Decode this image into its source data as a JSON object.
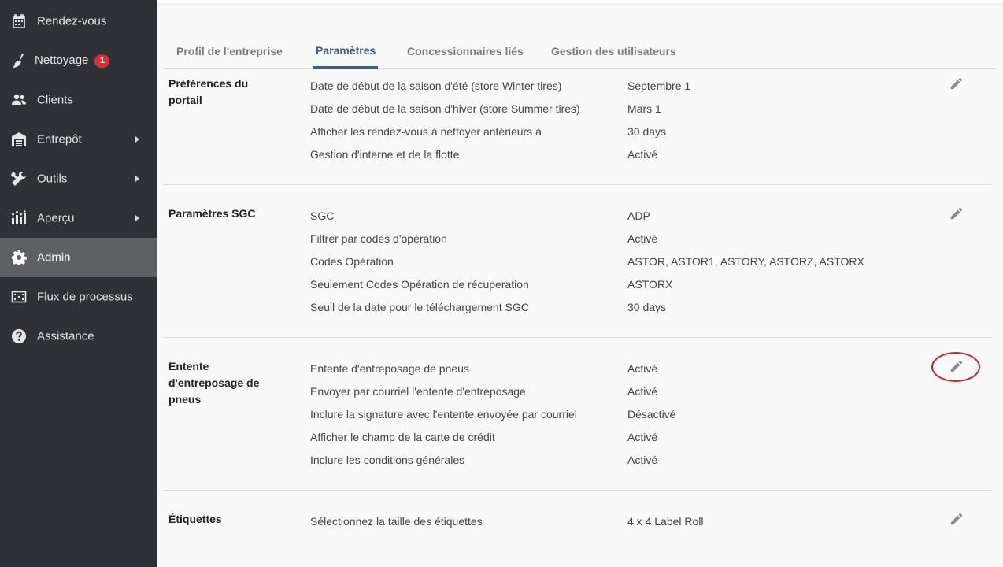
{
  "sidebar": {
    "items": [
      {
        "label": "Rendez-vous",
        "icon": "calendar-icon"
      },
      {
        "label": "Nettoyage",
        "icon": "broom-icon",
        "badge": "1"
      },
      {
        "label": "Clients",
        "icon": "users-icon"
      },
      {
        "label": "Entrepôt",
        "icon": "warehouse-icon"
      },
      {
        "label": "Outils",
        "icon": "tools-icon"
      },
      {
        "label": "Aperçu",
        "icon": "chart-icon"
      },
      {
        "label": "Admin",
        "icon": "gear-icon",
        "active": true
      },
      {
        "label": "Flux de processus",
        "icon": "workflow-icon"
      },
      {
        "label": "Assistance",
        "icon": "help-icon"
      }
    ]
  },
  "tabs": [
    {
      "label": "Profil de l'entreprise"
    },
    {
      "label": "Paramètres",
      "active": true
    },
    {
      "label": "Concessionnaires liés"
    },
    {
      "label": "Gestion des utilisateurs"
    }
  ],
  "sections": [
    {
      "title": "Préférences du portail",
      "rows": [
        {
          "label": "Date de début de la saison d'été (store Winter tires)",
          "value": "Septembre 1"
        },
        {
          "label": "Date de début de la saison d'hiver (store Summer tires)",
          "value": "Mars 1"
        },
        {
          "label": "Afficher les rendez-vous à nettoyer antérieurs à",
          "value": "30 days"
        },
        {
          "label": "Gestion d'interne et de la flotte",
          "value": "Activé"
        }
      ]
    },
    {
      "title": "Paramètres SGC",
      "rows": [
        {
          "label": "SGC",
          "value": "ADP"
        },
        {
          "label": "Filtrer par codes d'opération",
          "value": "Activé"
        },
        {
          "label": "Codes Opération",
          "value": "ASTOR, ASTOR1, ASTORY, ASTORZ, ASTORX"
        },
        {
          "label": "Seulement Codes Opération de récuperation",
          "value": "ASTORX"
        },
        {
          "label": "Seuil de la date pour le téléchargement SGC",
          "value": "30 days"
        }
      ]
    },
    {
      "title": "Entente d'entreposage de pneus",
      "rows": [
        {
          "label": "Entente d'entreposage de pneus",
          "value": "Activé"
        },
        {
          "label": "Envoyer par courriel l'entente d'entreposage",
          "value": "Activé"
        },
        {
          "label": "Inclure la signature avec l'entente envoyée par courriel",
          "value": "Désactivé"
        },
        {
          "label": "Afficher le champ de la carte de crédit",
          "value": "Activé"
        },
        {
          "label": "Inclure les conditions générales",
          "value": "Activé"
        }
      ]
    },
    {
      "title": "Étiquettes",
      "rows": [
        {
          "label": "Sélectionnez la taille des étiquettes",
          "value": "4 x 4 Label Roll"
        }
      ]
    }
  ],
  "colors": {
    "sidebar_bg": "#2f3136",
    "sidebar_active": "#5f6063",
    "tab_active": "#3e5a86",
    "badge": "#d2323c",
    "highlight": "#d0202a"
  }
}
